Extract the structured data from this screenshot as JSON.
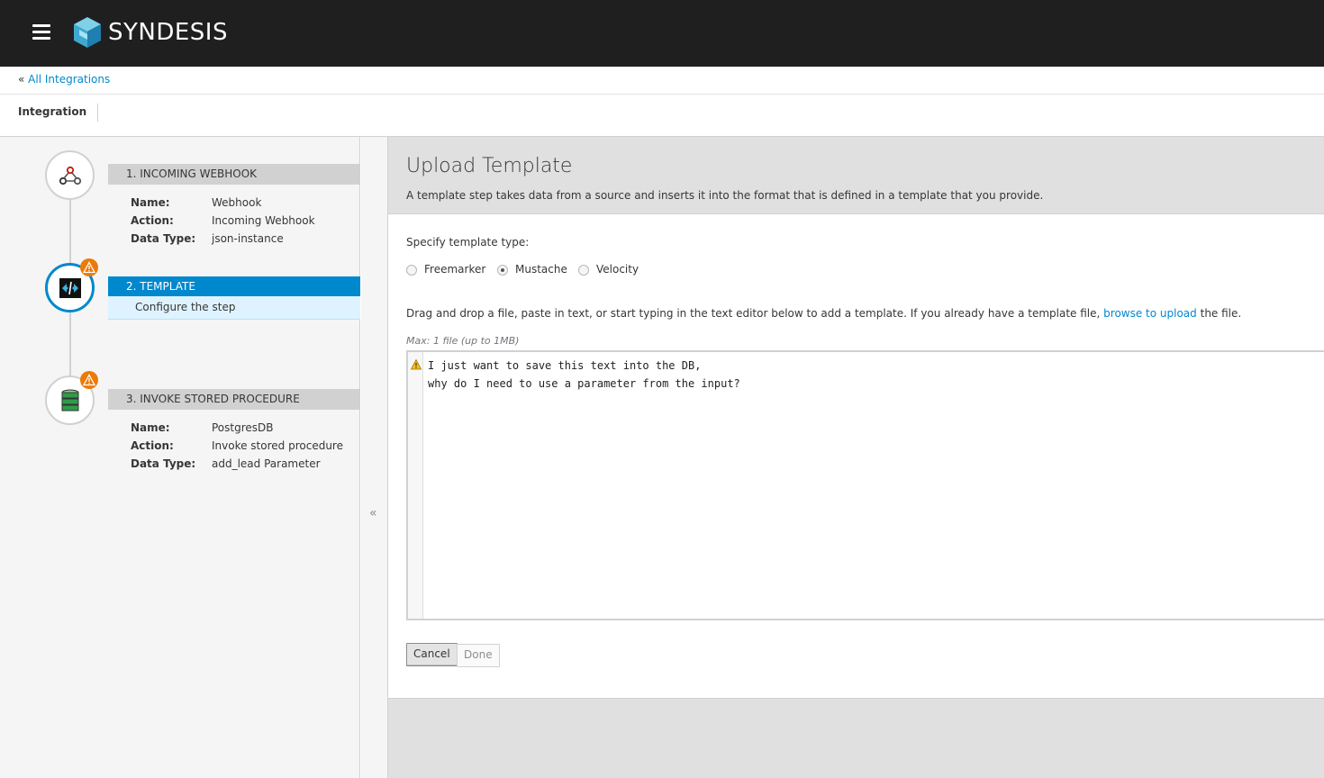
{
  "navbar": {
    "brand": "SYNDESIS",
    "menu_icon": "hamburger-icon",
    "logo_icon": "syndesis-logo-icon"
  },
  "breadcrumb": {
    "prefix": "«",
    "link": "All Integrations"
  },
  "header": {
    "title": "Integration"
  },
  "steps": [
    {
      "heading": "1. INCOMING WEBHOOK",
      "icon": "webhook-icon",
      "details": [
        {
          "key": "Name:",
          "value": "Webhook"
        },
        {
          "key": "Action:",
          "value": "Incoming Webhook"
        },
        {
          "key": "Data Type:",
          "value": "json-instance"
        }
      ]
    },
    {
      "heading": "2. TEMPLATE",
      "icon": "template-icon",
      "subtitle": "Configure the step",
      "warning": true,
      "active": true
    },
    {
      "heading": "3. INVOKE STORED PROCEDURE",
      "icon": "database-icon",
      "warning": true,
      "details": [
        {
          "key": "Name:",
          "value": "PostgresDB"
        },
        {
          "key": "Action:",
          "value": "Invoke stored procedure"
        },
        {
          "key": "Data Type:",
          "value": "add_lead Parameter"
        }
      ]
    }
  ],
  "collapse": {
    "label": "«"
  },
  "main": {
    "title": "Upload Template",
    "description": "A template step takes data from a source and inserts it into the format that is defined in a template that you provide.",
    "type_label": "Specify template type:",
    "types": [
      {
        "label": "Freemarker",
        "selected": false
      },
      {
        "label": "Mustache",
        "selected": true
      },
      {
        "label": "Velocity",
        "selected": false
      }
    ],
    "drag_text_before": "Drag and drop a file, paste in text, or start typing in the text editor below to add a template. If you already have a template file,",
    "drag_link": "browse to upload",
    "drag_text_after": "the file.",
    "max_text": "Max: 1 file (up to 1MB)",
    "editor_lines": "I just want to save this text into the DB,\nwhy do I need to use a parameter from the input?",
    "cancel_label": "Cancel",
    "done_label": "Done"
  },
  "colors": {
    "navbar_bg": "#1f1f1f",
    "accent": "#0088ce",
    "warning": "#ec7a08"
  }
}
